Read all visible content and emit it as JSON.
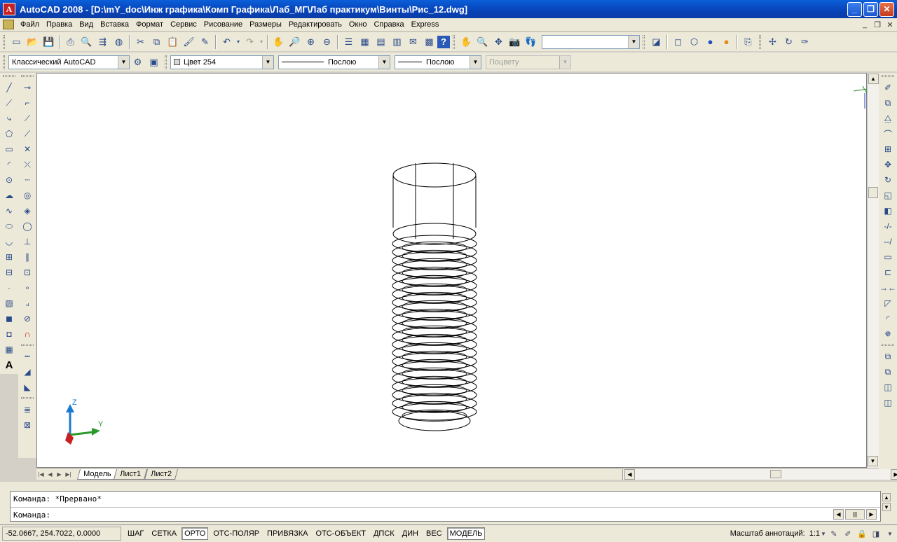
{
  "window": {
    "title": "AutoCAD 2008 - [D:\\mY_doc\\Инж графика\\Комп Графика\\Лаб_МГ\\Лаб практикум\\Винты\\Рис_12.dwg]",
    "app_icon": "A"
  },
  "menu": [
    {
      "id": "file",
      "label": "Файл"
    },
    {
      "id": "edit",
      "label": "Правка"
    },
    {
      "id": "view",
      "label": "Вид"
    },
    {
      "id": "insert",
      "label": "Вставка"
    },
    {
      "id": "format",
      "label": "Формат"
    },
    {
      "id": "tools",
      "label": "Сервис"
    },
    {
      "id": "draw",
      "label": "Рисование"
    },
    {
      "id": "dimension",
      "label": "Размеры"
    },
    {
      "id": "modify",
      "label": "Редактировать"
    },
    {
      "id": "window",
      "label": "Окно"
    },
    {
      "id": "help",
      "label": "Справка"
    },
    {
      "id": "express",
      "label": "Express"
    }
  ],
  "toolbar2": {
    "workspace": "Классический AutoCAD",
    "color": "Цвет 254",
    "linetype": "Послою",
    "lineweight": "Послою",
    "plotstyle": "Поцвету"
  },
  "layout_tabs": [
    {
      "id": "model",
      "label": "Модель",
      "active": true
    },
    {
      "id": "sheet1",
      "label": "Лист1",
      "active": false
    },
    {
      "id": "sheet2",
      "label": "Лист2",
      "active": false
    }
  ],
  "ucs": {
    "z": "Z",
    "y": "Y"
  },
  "command": {
    "history": "Команда: *Прервано*",
    "prompt": "Команда:",
    "input_value": ""
  },
  "status": {
    "coords": "-52.0667, 254.7022, 0.0000",
    "buttons": [
      {
        "id": "snap",
        "label": "ШАГ",
        "on": false
      },
      {
        "id": "grid",
        "label": "СЕТКА",
        "on": false
      },
      {
        "id": "ortho",
        "label": "ОРТО",
        "on": true
      },
      {
        "id": "polar",
        "label": "ОТС-ПОЛЯР",
        "on": false
      },
      {
        "id": "osnap",
        "label": "ПРИВЯЗКА",
        "on": false
      },
      {
        "id": "otrack",
        "label": "ОТС-ОБЪЕКТ",
        "on": false
      },
      {
        "id": "ducs",
        "label": "ДПСК",
        "on": false
      },
      {
        "id": "dyn",
        "label": "ДИН",
        "on": false
      },
      {
        "id": "lwt",
        "label": "ВЕС",
        "on": false
      },
      {
        "id": "model",
        "label": "МОДЕЛЬ",
        "on": true
      }
    ],
    "annotation_scale_label": "Масштаб аннотаций:",
    "annotation_scale_value": "1:1"
  }
}
